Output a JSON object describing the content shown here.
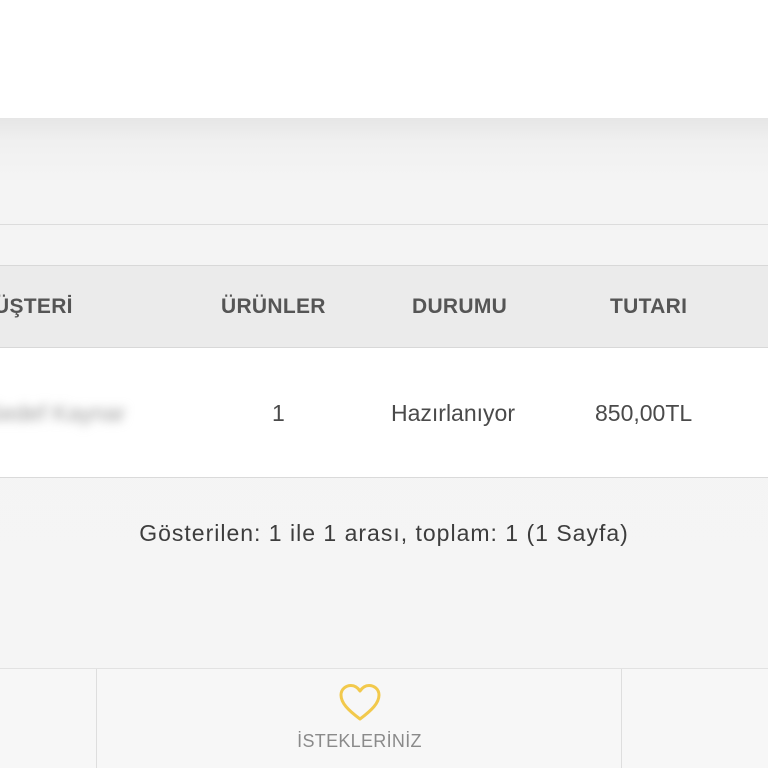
{
  "orders_table": {
    "headers": {
      "customer": "ÜŞTERİ",
      "products": "ÜRÜNLER",
      "status": "DURUMU",
      "total": "TUTARI"
    },
    "rows": [
      {
        "customer": "Sedef Kaynar",
        "products": "1",
        "status": "Hazırlanıyor",
        "total": "850,00TL"
      }
    ]
  },
  "pagination": {
    "info": "Gösterilen: 1 ile 1 arası, toplam: 1 (1 Sayfa)"
  },
  "bottom_nav": {
    "wishlist_label": "İSTEKLERİNİZ",
    "wishlist_icon": "heart-icon",
    "accent_color": "#f2c94c"
  }
}
